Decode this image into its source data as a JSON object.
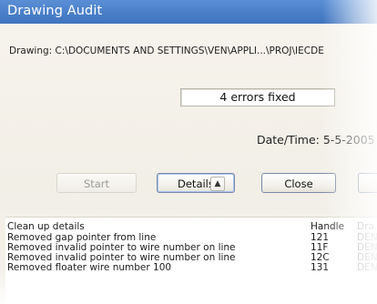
{
  "window": {
    "title": "Drawing Audit"
  },
  "drawing": {
    "label": "Drawing:",
    "path": "C:\\DOCUMENTS AND SETTINGS\\VEN\\APPLI...\\PROJ\\IECDE"
  },
  "status": {
    "errors_fixed": "4 errors fixed",
    "datetime": "Date/Time: 5-5-2005"
  },
  "buttons": {
    "start": "Start",
    "details": "Details",
    "details_icon": "double-chevron-up-icon",
    "close": "Close"
  },
  "details_table": {
    "columns": [
      "Clean up details",
      "Handle",
      "Dra"
    ],
    "rows": [
      {
        "detail": "Removed gap pointer from line",
        "handle": "121",
        "drawing": "DEN"
      },
      {
        "detail": "Removed invalid pointer to wire number on line",
        "handle": "11F",
        "drawing": "DEN"
      },
      {
        "detail": "Removed invalid pointer to wire number on line",
        "handle": "12C",
        "drawing": "DEN"
      },
      {
        "detail": "Removed floater wire number 100",
        "handle": "131",
        "drawing": "DEN"
      }
    ]
  },
  "colors": {
    "titlebar": "#4a7fc8",
    "dialog_bg": "#f4f1ea",
    "disabled_text": "#9c9b95"
  }
}
